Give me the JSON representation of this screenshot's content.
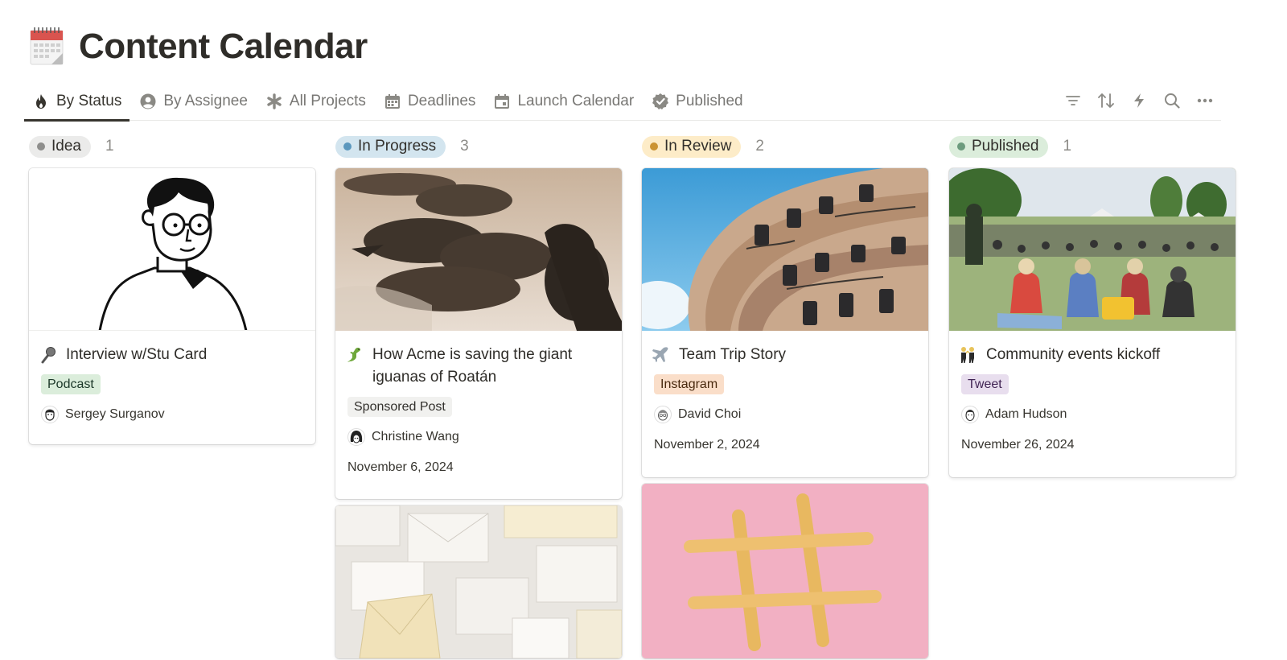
{
  "page": {
    "title": "Content Calendar",
    "icon": "calendar-icon"
  },
  "tabs": [
    {
      "label": "By Status",
      "icon": "flame-icon",
      "active": true
    },
    {
      "label": "By Assignee",
      "icon": "person-circle-icon",
      "active": false
    },
    {
      "label": "All Projects",
      "icon": "asterisk-icon",
      "active": false
    },
    {
      "label": "Deadlines",
      "icon": "calendar-grid-icon",
      "active": false
    },
    {
      "label": "Launch Calendar",
      "icon": "calendar-icon",
      "active": false
    },
    {
      "label": "Published",
      "icon": "verified-badge-icon",
      "active": false
    }
  ],
  "toolbar": [
    "filter-icon",
    "sort-icon",
    "lightning-icon",
    "search-icon",
    "more-icon"
  ],
  "columns": [
    {
      "status": "Idea",
      "count": "1",
      "pill_bg": "#ebebea",
      "dot": "#8e8e8c",
      "cards": [
        {
          "title": "Interview w/Stu Card",
          "emoji": "microphone-icon",
          "tag": "Podcast",
          "tag_bg": "#dbeddb",
          "tag_color": "#1c3829",
          "assignee": "Sergey Surganov",
          "date": "",
          "cover": "illustration-portrait"
        }
      ]
    },
    {
      "status": "In Progress",
      "count": "3",
      "pill_bg": "#d3e5ef",
      "dot": "#5b97bd",
      "cards": [
        {
          "title": "How Acme is saving the giant iguanas of Roatán",
          "emoji": "lizard-icon",
          "tag": "Sponsored Post",
          "tag_bg": "#f1f1ef",
          "tag_color": "#32302c",
          "assignee": "Christine Wang",
          "date": "November 6, 2024",
          "cover": "photo-iguanas"
        },
        {
          "title": "",
          "cover": "photo-envelopes"
        }
      ]
    },
    {
      "status": "In Review",
      "count": "2",
      "pill_bg": "#fdecc8",
      "dot": "#cb9434",
      "cards": [
        {
          "title": "Team Trip Story",
          "emoji": "airplane-icon",
          "tag": "Instagram",
          "tag_bg": "#fadec9",
          "tag_color": "#49290e",
          "assignee": "David Choi",
          "date": "November 2, 2024",
          "cover": "photo-building"
        },
        {
          "title": "",
          "cover": "photo-hashtag"
        }
      ]
    },
    {
      "status": "Published",
      "count": "1",
      "pill_bg": "#dbeddb",
      "dot": "#6c9b7d",
      "cards": [
        {
          "title": "Community events kickoff",
          "emoji": "people-dancing-icon",
          "tag": "Tweet",
          "tag_bg": "#e8deee",
          "tag_color": "#412454",
          "assignee": "Adam Hudson",
          "date": "November 26, 2024",
          "cover": "photo-festival"
        }
      ]
    }
  ]
}
